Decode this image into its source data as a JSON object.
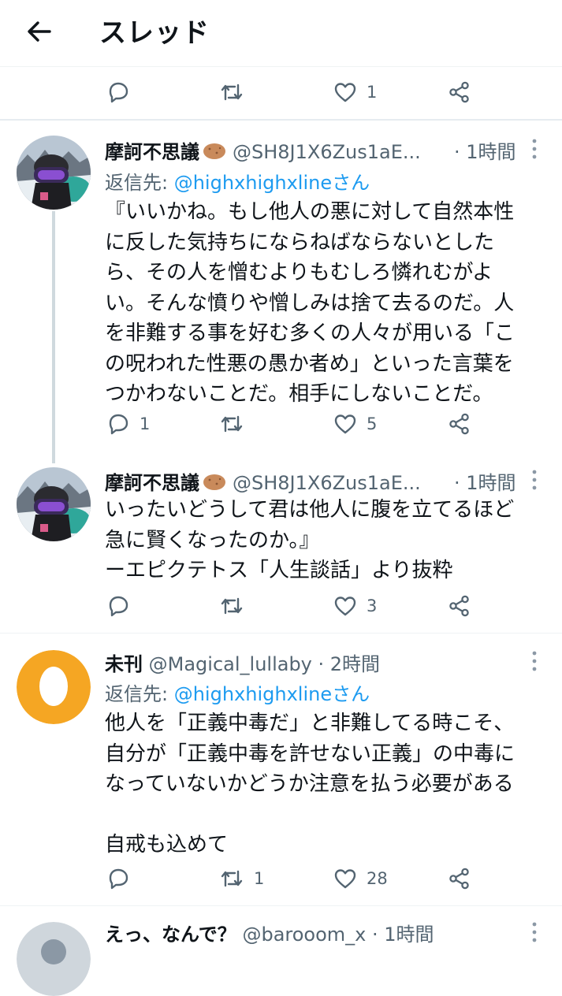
{
  "header": {
    "title": "スレッド"
  },
  "top_actions": {
    "like_count": "1"
  },
  "tweets": [
    {
      "name": "摩訶不思議",
      "handle": "@SH8J1X6Zus1aE...",
      "time": "· 1時間",
      "reply_prefix": "返信先: ",
      "reply_to": "@highxhighxlineさん",
      "text": "『いいかね。もし他人の悪に対して自然本性\nに反した気持ちにならねばならないとした\nら、その人を憎むよりもむしろ憐れむがよ\nい。そんな憤りや憎しみは捨て去るのだ。人\nを非難する事を好む多くの人々が用いる「こ\nの呪われた性悪の愚か者め」といった言葉を\nつかわないことだ。相手にしないことだ。",
      "reply_count": "1",
      "retweet_count": "",
      "like_count": "5"
    },
    {
      "name": "摩訶不思議",
      "handle": "@SH8J1X6Zus1aE...",
      "time": "· 1時間",
      "text": "いったいどうして君は他人に腹を立てるほど\n急に賢くなったのか。』\nーエピクテトス「人生談話」より抜粋",
      "reply_count": "",
      "retweet_count": "",
      "like_count": "3"
    },
    {
      "name": "未刊",
      "handle": "@Magical_lullaby",
      "time": "· 2時間",
      "reply_prefix": "返信先: ",
      "reply_to": "@highxhighxlineさん",
      "text": "他人を「正義中毒だ」と非難してる時こそ、\n自分が「正義中毒を許せない正義」の中毒に\nなっていないかどうか注意を払う必要がある\n\n自戒も込めて",
      "reply_count": "",
      "retweet_count": "1",
      "like_count": "28"
    },
    {
      "name": "えっ、なんで？",
      "handle": "@barooom_x",
      "time": "· 1時間"
    }
  ],
  "colors": {
    "accent": "#1d9bf0",
    "secondary": "#536471",
    "avatar_orange": "#f5a623"
  }
}
